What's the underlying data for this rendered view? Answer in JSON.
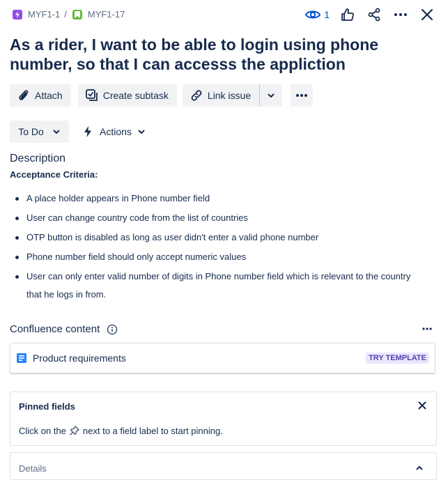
{
  "breadcrumb": {
    "parent": "MYF1-1",
    "separator": "/",
    "current": "MYF1-17"
  },
  "header": {
    "watchers_count": "1",
    "icons": [
      "eye-icon",
      "thumbs-up-icon",
      "share-icon",
      "more-icon",
      "close-icon"
    ]
  },
  "issue": {
    "title": "As a rider, I want to be able to login using phone number, so that I can accesss the appliction"
  },
  "toolbar": {
    "attach_label": "Attach",
    "create_subtask_label": "Create subtask",
    "link_issue_label": "Link issue"
  },
  "status": {
    "value": "To Do",
    "actions_label": "Actions"
  },
  "description": {
    "heading": "Description",
    "subheading": "Acceptance Criteria:",
    "items": [
      "A place holder appears in Phone number field",
      "User can change country code from the list of countries",
      "OTP button is disabled as long as user didn't enter a valid phone number",
      "Phone number field should only accept numeric values",
      "User can only enter valid number of digits in Phone number field which is relevant to the country that he logs in from."
    ]
  },
  "confluence": {
    "heading": "Confluence content",
    "item_label": "Product requirements",
    "try_template_label": "TRY TEMPLATE"
  },
  "pinned": {
    "heading": "Pinned fields",
    "text_before": "Click on the",
    "text_after": "next to a field label to start pinning."
  },
  "details": {
    "label": "Details"
  },
  "colors": {
    "primary_text": "#172b4d",
    "secondary_text": "#5e6c84",
    "link_blue": "#0052cc",
    "epic_purple": "#904ee2",
    "story_green": "#63ba3c",
    "button_bg": "#f1f2f4",
    "template_purple": "#5243aa"
  }
}
